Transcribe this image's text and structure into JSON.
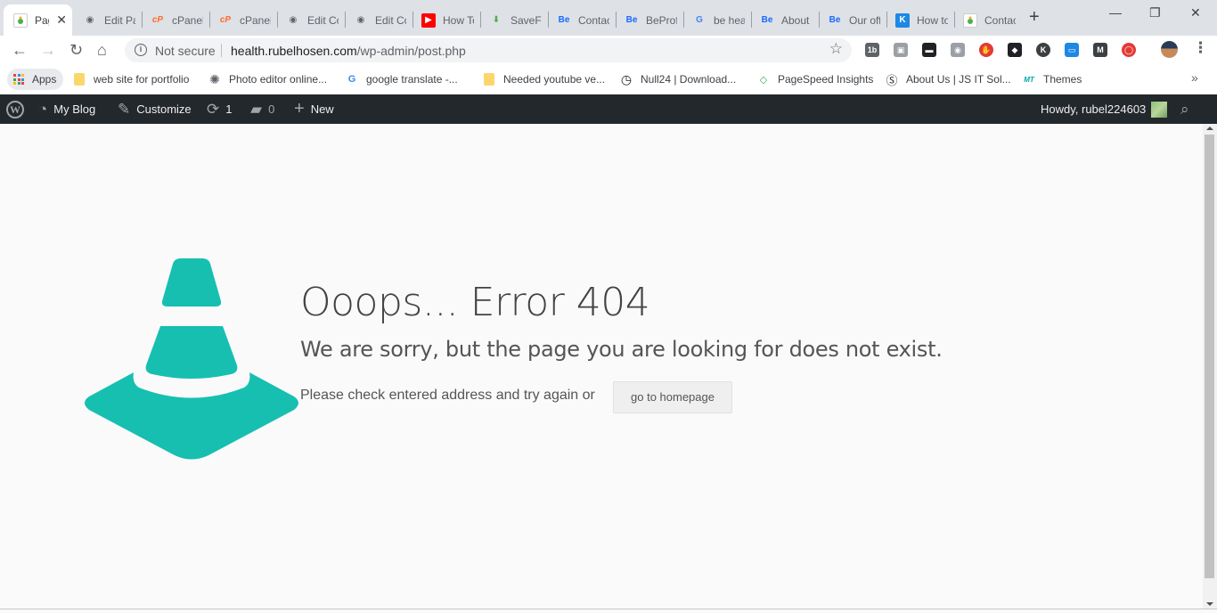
{
  "browser": {
    "tabs": [
      {
        "title": "Page Not Found",
        "favicon": "wp-health-icon",
        "active": true
      },
      {
        "title": "Edit Page",
        "favicon": "globe-icon"
      },
      {
        "title": "cPanel",
        "favicon": "cpanel-icon"
      },
      {
        "title": "cPanel",
        "favicon": "cpanel-icon"
      },
      {
        "title": "Edit Contact",
        "favicon": "globe-icon"
      },
      {
        "title": "Edit Contact",
        "favicon": "globe-icon"
      },
      {
        "title": "How To",
        "favicon": "youtube-icon"
      },
      {
        "title": "SaveFrom",
        "favicon": "savefrom-icon"
      },
      {
        "title": "Contact",
        "favicon": "behance-icon"
      },
      {
        "title": "BeProfile",
        "favicon": "behance-icon"
      },
      {
        "title": "be health",
        "favicon": "google-icon"
      },
      {
        "title": "About",
        "favicon": "behance-icon"
      },
      {
        "title": "Our office",
        "favicon": "behance-icon"
      },
      {
        "title": "How to",
        "favicon": "k-icon"
      },
      {
        "title": "Contact",
        "favicon": "wp-health-icon"
      }
    ],
    "address": {
      "security_label": "Not secure",
      "host": "health.rubelhosen.com",
      "path": "/wp-admin/post.php"
    },
    "extensions": [
      {
        "name": "1b-extension-icon",
        "color": "#5f6368",
        "glyph": "1b"
      },
      {
        "name": "profile-extension-icon",
        "color": "#9aa0a6",
        "glyph": "▣"
      },
      {
        "name": "mask-extension-icon",
        "color": "#202124",
        "glyph": "▬"
      },
      {
        "name": "camera-extension-icon",
        "color": "#9aa0a6",
        "glyph": "◉"
      },
      {
        "name": "adblock-extension-icon",
        "color": "#e53935",
        "glyph": "✋"
      },
      {
        "name": "cube-extension-icon",
        "color": "#202124",
        "glyph": "◆"
      },
      {
        "name": "k-extension-icon",
        "color": "#3c4043",
        "glyph": "K"
      },
      {
        "name": "screen-extension-icon",
        "color": "#1e88e5",
        "glyph": "▭"
      },
      {
        "name": "m-extension-icon",
        "color": "#3c4043",
        "glyph": "M"
      },
      {
        "name": "opera-extension-icon",
        "color": "#e53935",
        "glyph": "◯"
      }
    ],
    "bookmarks": {
      "apps_label": "Apps",
      "items": [
        {
          "label": "web site for portfolio",
          "icon": "folder-icon"
        },
        {
          "label": "Photo editor online...",
          "icon": "aperture-icon"
        },
        {
          "label": "google translate -...",
          "icon": "google-icon"
        },
        {
          "label": "Needed youtube ve...",
          "icon": "folder-icon"
        },
        {
          "label": "Null24 | Download...",
          "icon": "clock-icon"
        },
        {
          "label": "PageSpeed Insights",
          "icon": "pagespeed-icon"
        },
        {
          "label": "About Us | JS IT Sol...",
          "icon": "js-icon"
        },
        {
          "label": "Themes",
          "icon": "mt-icon"
        }
      ]
    }
  },
  "adminbar": {
    "site_name": "My Blog",
    "customize_label": "Customize",
    "updates_count": "1",
    "comments_count": "0",
    "new_label": "New",
    "greeting": "Howdy, rubel224603"
  },
  "error_page": {
    "title": "Ooops... Error 404",
    "subtitle": "We are sorry, but the page you are looking for does not exist.",
    "instruction": "Please check entered address and try again or",
    "button_label": "go to homepage",
    "accent_color": "#17bfb1"
  }
}
